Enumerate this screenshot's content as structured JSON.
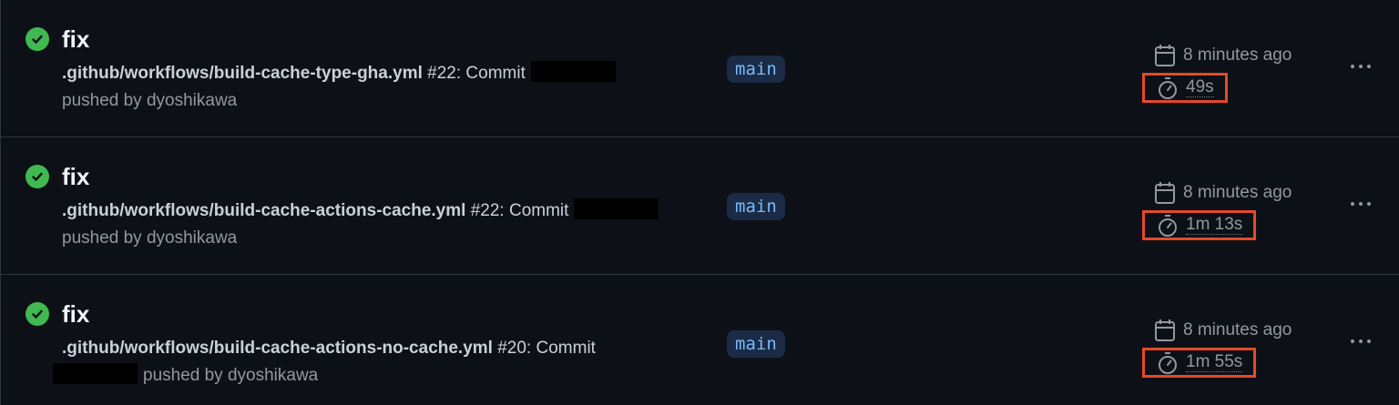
{
  "runs": [
    {
      "title": "fix",
      "workflow": ".github/workflows/build-cache-type-gha.yml",
      "run_number": "#22:",
      "commit_label": "Commit",
      "pushed_by": "pushed by dyoshikawa",
      "branch": "main",
      "time_ago": "8 minutes ago",
      "duration": "49s"
    },
    {
      "title": "fix",
      "workflow": ".github/workflows/build-cache-actions-cache.yml",
      "run_number": "#22:",
      "commit_label": "Commit",
      "pushed_by": "pushed by dyoshikawa",
      "branch": "main",
      "time_ago": "8 minutes ago",
      "duration": "1m 13s"
    },
    {
      "title": "fix",
      "workflow": ".github/workflows/build-cache-actions-no-cache.yml",
      "run_number": "#20:",
      "commit_label": "Commit",
      "pushed_by": "pushed by dyoshikawa",
      "branch": "main",
      "time_ago": "8 minutes ago",
      "duration": "1m 55s"
    }
  ],
  "colors": {
    "background": "#0d1117",
    "success": "#3fb950",
    "highlight_box": "#e5492b",
    "branch_bg": "#1b2b45",
    "branch_text": "#79b8ff"
  },
  "icons": {
    "status": "check-circle-icon",
    "date": "calendar-icon",
    "duration": "stopwatch-icon",
    "menu": "kebab-horizontal-icon"
  }
}
